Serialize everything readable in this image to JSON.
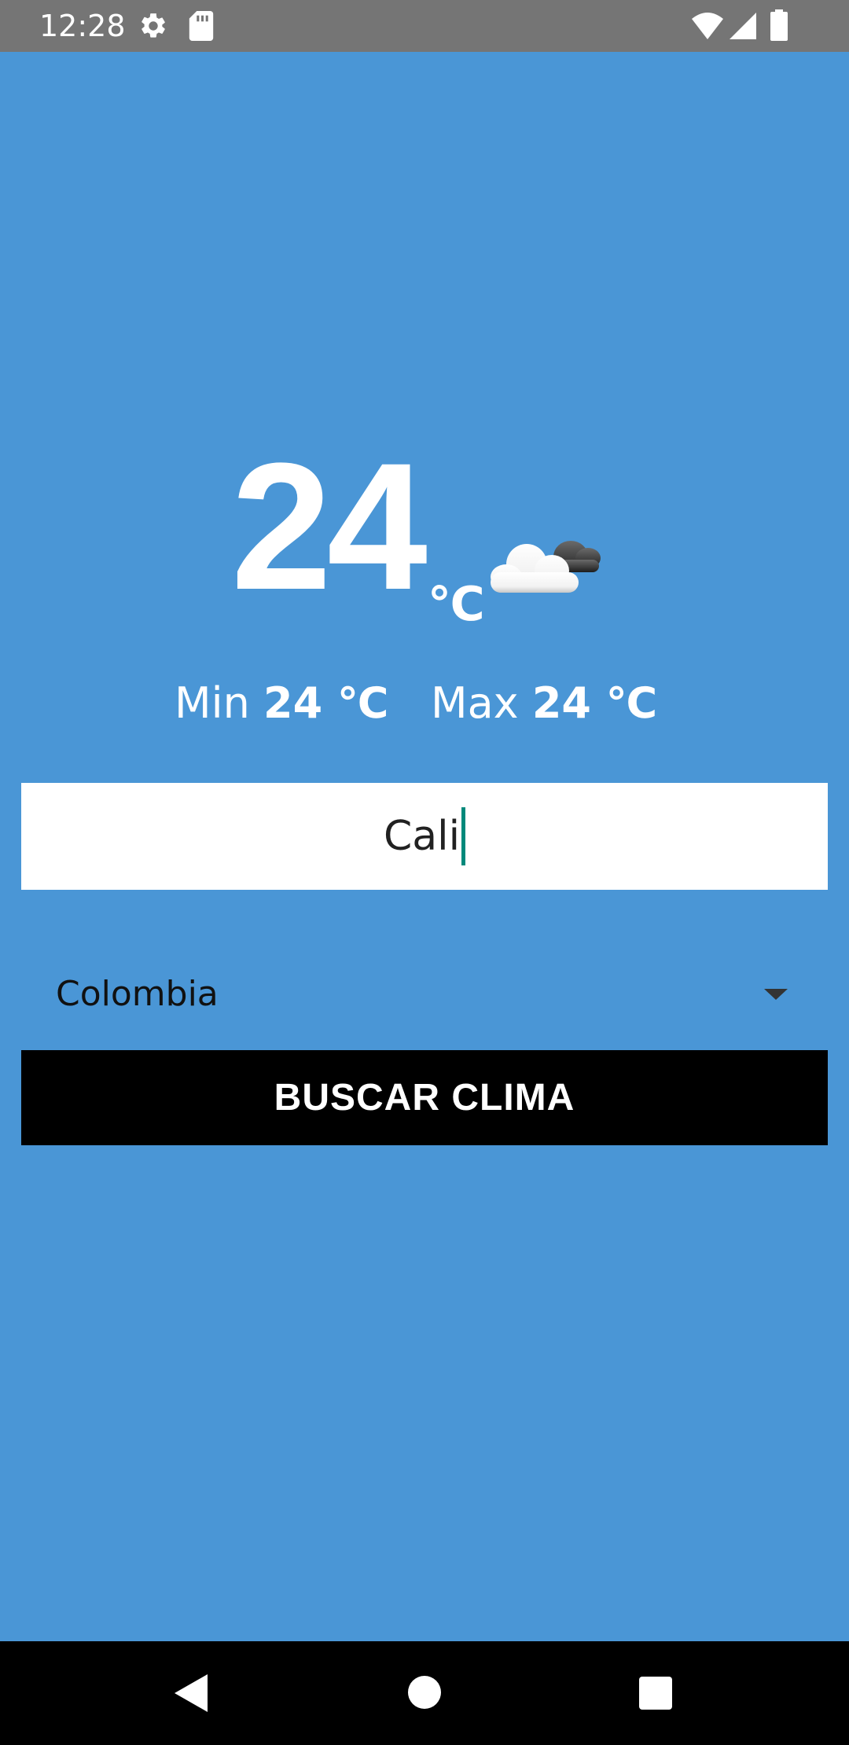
{
  "status_bar": {
    "time": "12:28",
    "icons": [
      "gear-icon",
      "sd-card-icon",
      "wifi-icon",
      "signal-icon",
      "battery-icon"
    ]
  },
  "weather": {
    "temperature": "24",
    "unit": "℃",
    "condition_icon": "partly-cloudy-icon",
    "min_label": "Min",
    "min_value": "24 ℃",
    "max_label": "Max",
    "max_value": "24 ℃"
  },
  "search": {
    "city_value": "Cali",
    "country_selected": "Colombia",
    "button_label": "BUSCAR CLIMA"
  },
  "nav_bar": {
    "icons": [
      "back-icon",
      "home-icon",
      "recents-icon"
    ]
  },
  "colors": {
    "background": "#4a96d6",
    "status_bar": "#757575",
    "button": "#000000",
    "caret": "#00897b"
  }
}
